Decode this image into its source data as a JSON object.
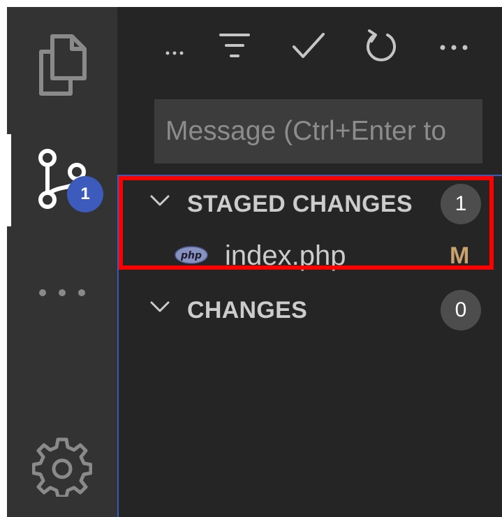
{
  "activity_bar": {
    "items": [
      {
        "icon": "files-icon"
      },
      {
        "icon": "source-control-icon",
        "badge": "1"
      },
      {
        "icon": "more-icon"
      },
      {
        "icon": "settings-gear-icon"
      }
    ]
  },
  "toolbar": {
    "icons": [
      "views-overflow-icon",
      "filter-icon",
      "commit-check-icon",
      "refresh-icon",
      "more-actions-icon"
    ]
  },
  "commit_message": {
    "placeholder": "Message (Ctrl+Enter to",
    "value": ""
  },
  "staged_changes": {
    "title": "STAGED CHANGES",
    "count": "1",
    "files": [
      {
        "name": "index.php",
        "icon": "php-file-icon",
        "status": "M"
      }
    ]
  },
  "changes": {
    "title": "CHANGES",
    "count": "0"
  },
  "colors": {
    "activity_bg": "#333333",
    "sidebar_bg": "#252526",
    "badge_blue": "#3c5bbd",
    "modified": "#c9a26d",
    "highlight": "#ff0000",
    "focus_border": "#3b5ab5"
  }
}
